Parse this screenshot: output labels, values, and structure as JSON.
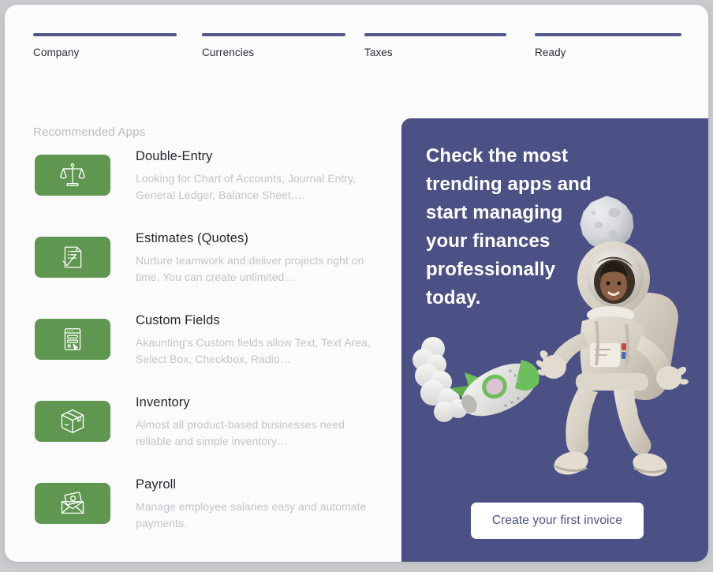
{
  "wizard": {
    "steps": [
      {
        "label": "Company",
        "completed": true
      },
      {
        "label": "Currencies",
        "completed": true
      },
      {
        "label": "Taxes",
        "completed": true
      },
      {
        "label": "Ready",
        "completed": true
      }
    ],
    "bar_color": "#51568a"
  },
  "apps_panel": {
    "heading": "Recommended Apps",
    "icon_tile_color": "#5f9650",
    "items": [
      {
        "title": "Double-Entry",
        "description": "Looking for Chart of Accounts, Journal Entry, General Ledger, Balance Sheet,…",
        "icon": "balance-scales-icon"
      },
      {
        "title": "Estimates (Quotes)",
        "description": "Nurture teamwork and deliver projects right on time. You can create unlimited…",
        "icon": "document-check-icon"
      },
      {
        "title": "Custom Fields",
        "description": "Akaunting's Custom fields allow Text, Text Area, Select Box, Checkbox, Radio…",
        "icon": "form-window-icon"
      },
      {
        "title": "Inventory",
        "description": "Almost all product-based businesses need reliable and simple inventory…",
        "icon": "box-package-icon"
      },
      {
        "title": "Payroll",
        "description": "Manage employee salaries easy and automate payments.",
        "icon": "money-envelope-icon"
      }
    ]
  },
  "promo": {
    "heading": "Check the most trending apps and start managing your finances professionally today.",
    "cta_label": "Create your first invoice",
    "background_color": "#4c5185",
    "cta_text_color": "#4c5185",
    "illustrations": [
      "moon-icon",
      "astronaut-icon",
      "rocket-icon"
    ]
  }
}
